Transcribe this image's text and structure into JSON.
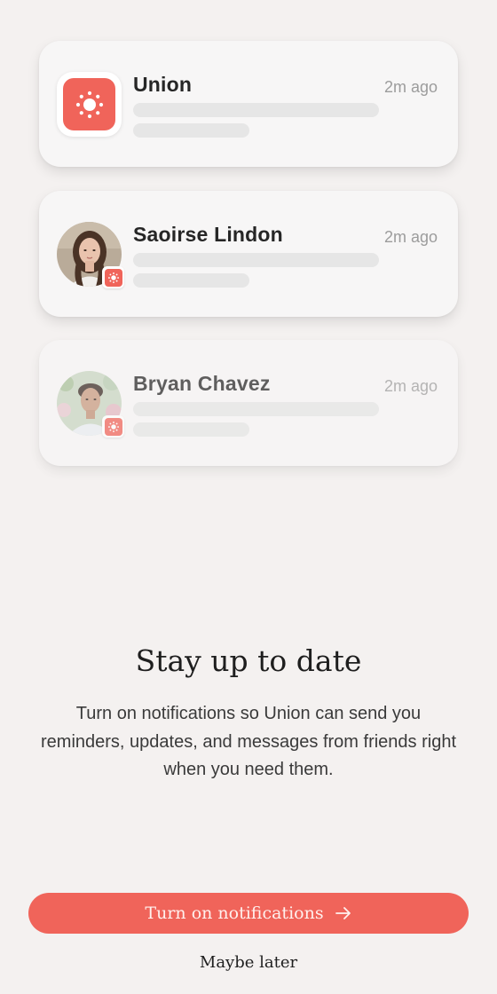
{
  "accent_color": "#f0645a",
  "notifications": [
    {
      "name": "Union",
      "time": "2m ago",
      "avatar": "union-app-icon"
    },
    {
      "name": "Saoirse Lindon",
      "time": "2m ago",
      "avatar": "profile-photo",
      "badge": "union-badge-icon"
    },
    {
      "name": "Bryan Chavez",
      "time": "2m ago",
      "avatar": "profile-photo",
      "badge": "union-badge-icon"
    }
  ],
  "headline": "Stay up to date",
  "body": "Turn on notifications so Union can send you reminders, updates, and messages from friends right when you need them.",
  "primary_button": {
    "label": "Turn on notifications",
    "icon": "arrow-right-icon"
  },
  "secondary_link": {
    "label": "Maybe later"
  }
}
